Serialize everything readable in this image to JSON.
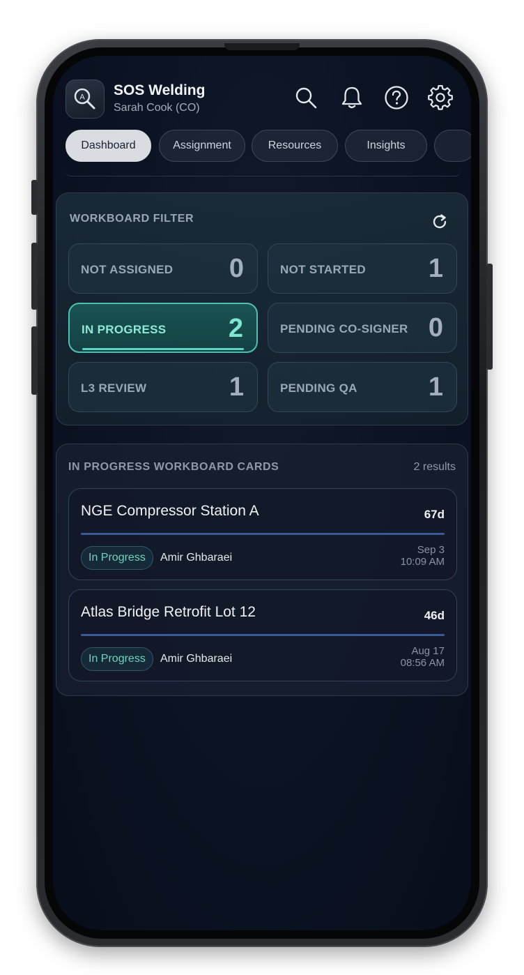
{
  "app": {
    "title": "SOS Welding",
    "subtitle": "Sarah Cook (CO)",
    "logo_letter": "A",
    "logo_icon": "magnifier-badge-icon"
  },
  "header_icons": [
    "search-icon",
    "bell-icon",
    "help-icon",
    "gear-icon"
  ],
  "tabs": [
    {
      "label": "Dashboard",
      "active": true
    },
    {
      "label": "Assignment",
      "active": false
    },
    {
      "label": "Resources",
      "active": false
    },
    {
      "label": "Insights",
      "active": false
    },
    {
      "label": "",
      "active": false
    }
  ],
  "filter": {
    "title": "WORKBOARD FILTER",
    "tiles": [
      {
        "label": "NOT ASSIGNED",
        "count": "0",
        "active": false
      },
      {
        "label": "NOT STARTED",
        "count": "1",
        "active": false
      },
      {
        "label": "IN PROGRESS",
        "count": "2",
        "active": true
      },
      {
        "label": "PENDING CO-SIGNER",
        "count": "0",
        "active": false
      },
      {
        "label": "L3 REVIEW",
        "count": "1",
        "active": false
      },
      {
        "label": "PENDING QA",
        "count": "1",
        "active": false
      }
    ]
  },
  "results": {
    "title": "IN PROGRESS WORKBOARD CARDS",
    "count": "2 results",
    "cards": [
      {
        "title": "NGE Compressor Station A",
        "days": "67d",
        "status": "In Progress",
        "assignee": "Amir Ghbaraei",
        "date": "Sep 3",
        "time": "10:09 AM"
      },
      {
        "title": "Atlas Bridge Retrofit Lot 12",
        "days": "46d",
        "status": "In Progress",
        "assignee": "Amir Ghbaraei",
        "date": "Aug 17",
        "time": "08:56 AM"
      }
    ]
  },
  "colors": {
    "accent": "#4fc2ad",
    "background": "#0c1424",
    "divider": "#3a5a96"
  }
}
